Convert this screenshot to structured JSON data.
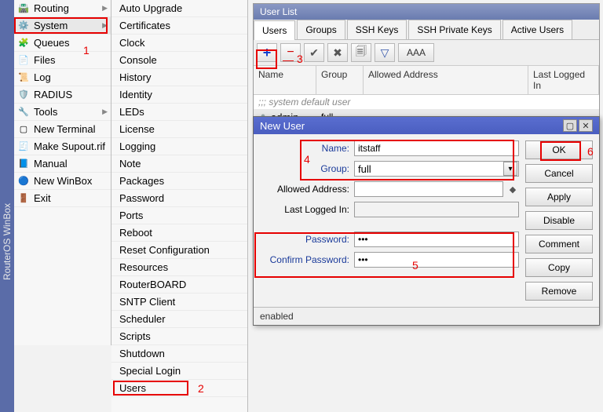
{
  "sideStrip": "RouterOS WinBox",
  "menu1": [
    {
      "label": "Routing",
      "icon": "🛣️",
      "arrow": true
    },
    {
      "label": "System",
      "icon": "⚙️",
      "arrow": true,
      "hover": true
    },
    {
      "label": "Queues",
      "icon": "🧩"
    },
    {
      "label": "Files",
      "icon": "📄"
    },
    {
      "label": "Log",
      "icon": "📜"
    },
    {
      "label": "RADIUS",
      "icon": "🛡️"
    },
    {
      "label": "Tools",
      "icon": "🔧",
      "arrow": true
    },
    {
      "label": "New Terminal",
      "icon": "▢"
    },
    {
      "label": "Make Supout.rif",
      "icon": "🧾"
    },
    {
      "label": "Manual",
      "icon": "📘"
    },
    {
      "label": "New WinBox",
      "icon": "🔵"
    },
    {
      "label": "Exit",
      "icon": "🚪"
    }
  ],
  "menu2": [
    "Auto Upgrade",
    "Certificates",
    "Clock",
    "Console",
    "History",
    "Identity",
    "LEDs",
    "License",
    "Logging",
    "Note",
    "Packages",
    "Password",
    "Ports",
    "Reboot",
    "Reset Configuration",
    "Resources",
    "RouterBOARD",
    "SNTP Client",
    "Scheduler",
    "Scripts",
    "Shutdown",
    "Special Login",
    "Users"
  ],
  "userList": {
    "title": "User List",
    "tabs": [
      "Users",
      "Groups",
      "SSH Keys",
      "SSH Private Keys",
      "Active Users"
    ],
    "aaa": "AAA",
    "headers": {
      "name": "Name",
      "group": "Group",
      "addr": "Allowed Address",
      "last": "Last Logged In"
    },
    "comment": ";;; system default user",
    "row": {
      "name": "admin",
      "group": "full"
    }
  },
  "dialog": {
    "title": "New User",
    "labels": {
      "name": "Name:",
      "group": "Group:",
      "addr": "Allowed Address:",
      "last": "Last Logged In:",
      "pw": "Password:",
      "cpw": "Confirm Password:"
    },
    "values": {
      "name": "itstaff",
      "group": "full",
      "pw": "***",
      "cpw": "***"
    },
    "buttons": {
      "ok": "OK",
      "cancel": "Cancel",
      "apply": "Apply",
      "disable": "Disable",
      "comment": "Comment",
      "copy": "Copy",
      "remove": "Remove"
    },
    "status": "enabled"
  },
  "annotations": {
    "n1": "1",
    "n2": "2",
    "n3": "3",
    "n4": "4",
    "n5": "5",
    "n6": "6",
    "dash": "—"
  }
}
